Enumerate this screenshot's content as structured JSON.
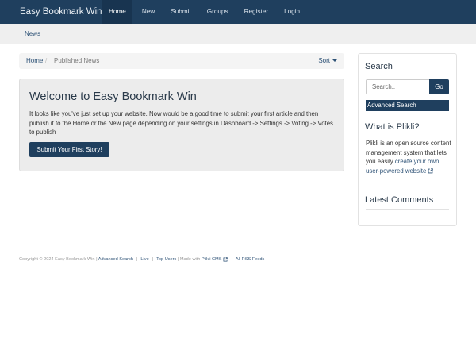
{
  "navbar": {
    "brand": "Easy Bookmark Win",
    "items": [
      {
        "label": "Home",
        "active": true
      },
      {
        "label": "New"
      },
      {
        "label": "Submit"
      },
      {
        "label": "Groups"
      },
      {
        "label": "Register"
      },
      {
        "label": "Login"
      }
    ]
  },
  "subnav": {
    "items": [
      {
        "label": "News"
      }
    ]
  },
  "breadcrumb": {
    "home": "Home",
    "separator": "/",
    "current": "Published News",
    "sort_label": "Sort"
  },
  "jumbotron": {
    "title": "Welcome to Easy Bookmark Win",
    "text": "It looks like you've just set up your website. Now would be a good time to submit your first article and then publish it to the Home or the New page depending on your settings in Dashboard -> Settings -> Voting -> Votes to publish",
    "button": "Submit Your First Story!"
  },
  "sidebar": {
    "search": {
      "heading": "Search",
      "placeholder": "Search..",
      "go": "Go",
      "advanced": "Advanced Search"
    },
    "about": {
      "heading": "What is Plikli?",
      "text": "Plikli is an open source content management system that lets you easily ",
      "link": "create your own user-powered website",
      "after": " ."
    },
    "comments": {
      "heading": "Latest Comments"
    }
  },
  "footer": {
    "copyright": "Copyright © 2024 Easy Bookmark Win |",
    "advanced_search": "Advanced Search",
    "live": "Live",
    "top_users": "Top Users",
    "made_with": "| Made with",
    "plikli": "Plikli CMS",
    "rss": "All RSS Feeds",
    "separator": "|"
  },
  "colors": {
    "navbar_bg": "#1f3f5e",
    "navbar_active_bg": "#183450",
    "link": "#2e5276",
    "button_bg": "#1f3f5e"
  },
  "icons": {
    "external_link": "external-link-icon",
    "sort_caret": "caret-down-icon"
  }
}
